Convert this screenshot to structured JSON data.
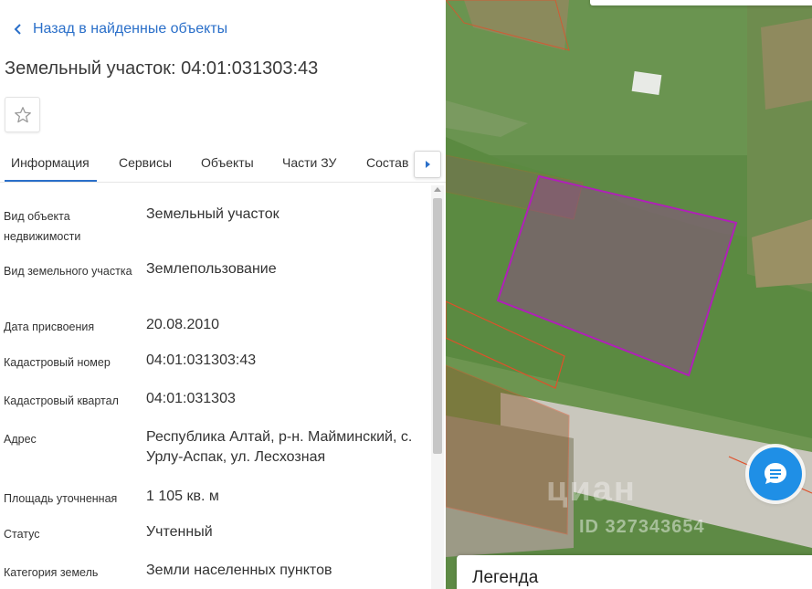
{
  "header": {
    "back_label": "Назад в найденные объекты",
    "title": "Земельный участок: 04:01:031303:43"
  },
  "tabs": [
    {
      "label": "Информация",
      "active": true
    },
    {
      "label": "Сервисы",
      "active": false
    },
    {
      "label": "Объекты",
      "active": false
    },
    {
      "label": "Части ЗУ",
      "active": false
    },
    {
      "label": "Состав",
      "active": false
    }
  ],
  "info": [
    {
      "key": "Вид объекта недвижимости",
      "value": "Земельный участок"
    },
    {
      "key": "Вид земельного участка",
      "value": "Землепользование"
    },
    {
      "key": "Дата присвоения",
      "value": "20.08.2010"
    },
    {
      "key": "Кадастровый номер",
      "value": "04:01:031303:43"
    },
    {
      "key": "Кадастровый квартал",
      "value": "04:01:031303"
    },
    {
      "key": "Адрес",
      "value": "Республика Алтай, р-н. Майминский, с. Урлу-Аспак, ул. Лесхозная"
    },
    {
      "key": "Площадь уточненная",
      "value": "1 105 кв. м"
    },
    {
      "key": "Статус",
      "value": "Учтенный"
    },
    {
      "key": "Категория земель",
      "value": "Земли населенных пунктов"
    }
  ],
  "map": {
    "watermark": "циан",
    "watermark_id": "ID 327343654",
    "legend_label": "Легенда",
    "parcel_color": "#b020b8",
    "boundary_color": "#e0502a"
  },
  "colors": {
    "accent": "#2a6fc9",
    "chat": "#1f8fe6"
  },
  "icons": {
    "back": "chevron-left-icon",
    "favorite": "star-icon",
    "tabs_next": "triangle-right-icon",
    "chat": "chat-icon"
  }
}
